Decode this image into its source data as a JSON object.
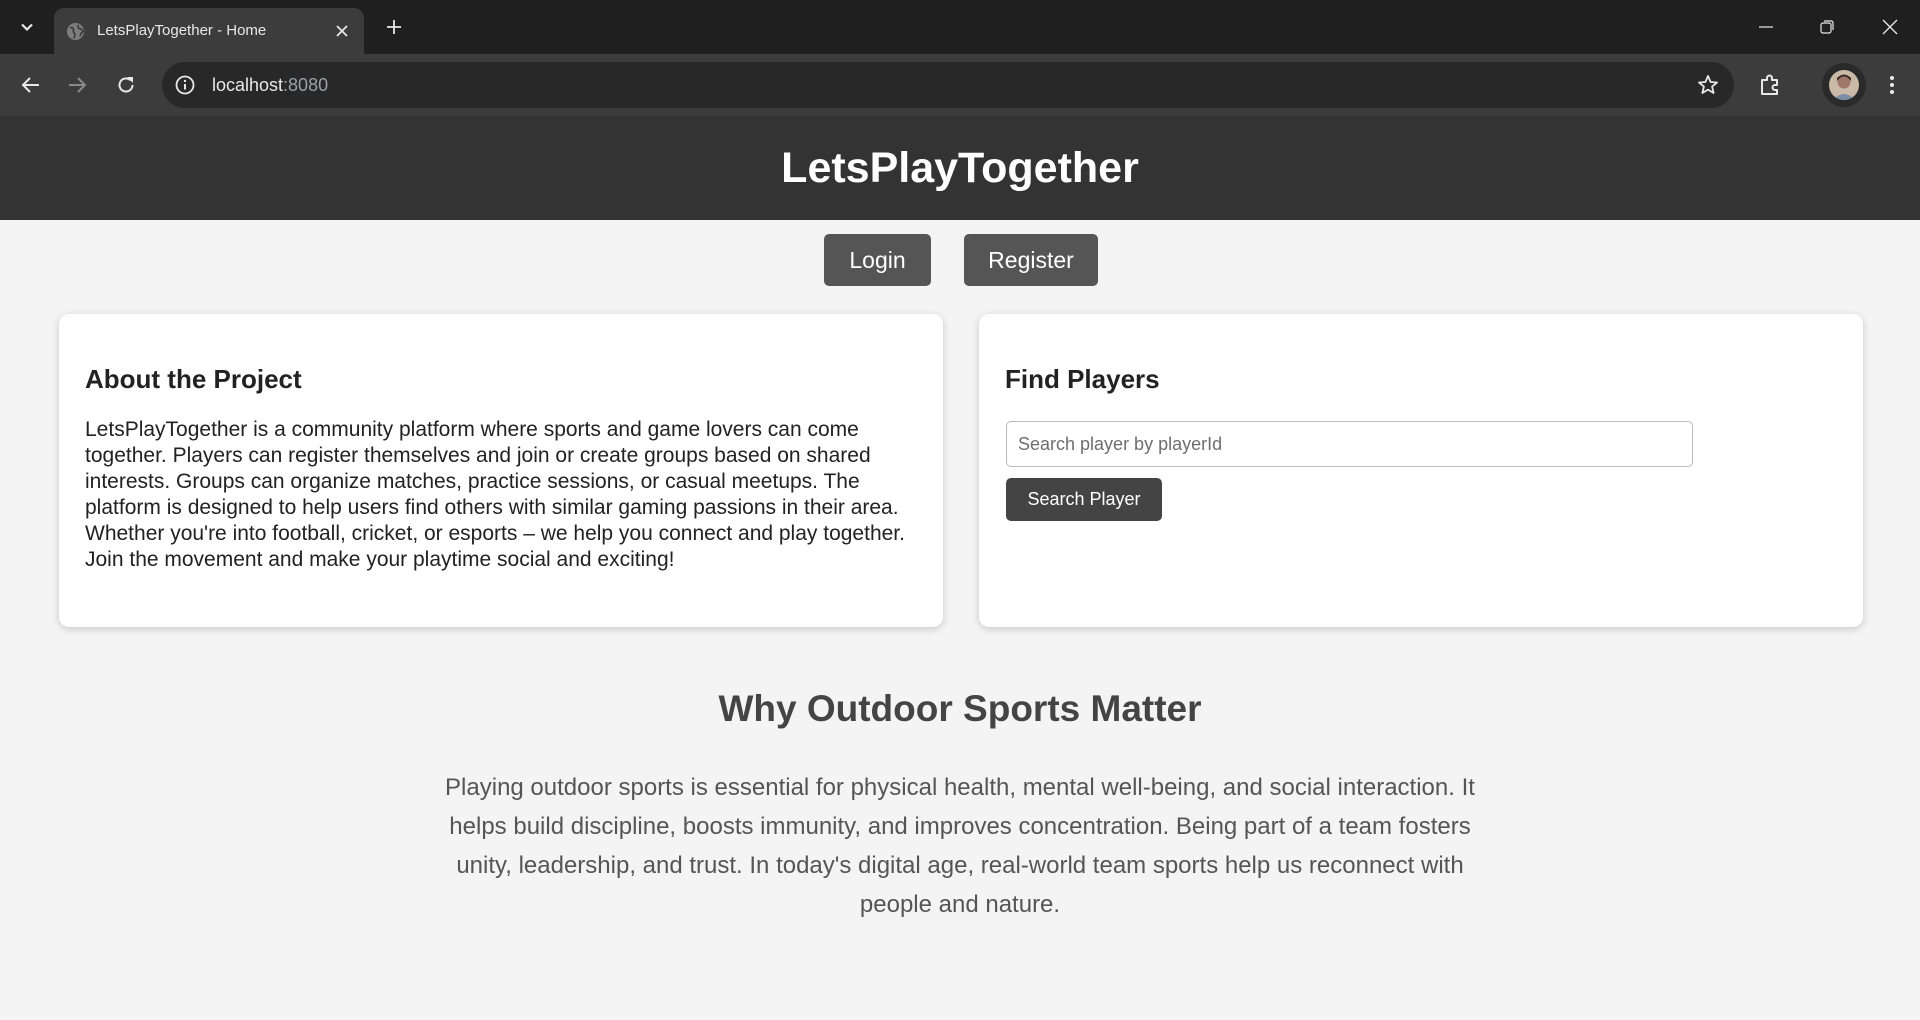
{
  "browser": {
    "tab_title": "LetsPlayTogether - Home",
    "url_host": "localhost",
    "url_port": ":8080"
  },
  "site": {
    "title": "LetsPlayTogether"
  },
  "auth": {
    "login_label": "Login",
    "register_label": "Register"
  },
  "about": {
    "heading": "About the Project",
    "body": "LetsPlayTogether is a community platform where sports and game lovers can come together. Players can register themselves and join or create groups based on shared interests. Groups can organize matches, practice sessions, or casual meetups. The platform is designed to help users find others with similar gaming passions in their area. Whether you're into football, cricket, or esports – we help you connect and play together. Join the movement and make your playtime social and exciting!"
  },
  "find_players": {
    "heading": "Find Players",
    "search_placeholder": "Search player by playerId",
    "search_value": "",
    "button_label": "Search Player"
  },
  "why": {
    "heading": "Why Outdoor Sports Matter",
    "body": "Playing outdoor sports is essential for physical health, mental well-being, and social interaction. It helps build discipline, boosts immunity, and improves concentration. Being part of a team fosters unity, leadership, and trust. In today's digital age, real-world team sports help us reconnect with people and nature."
  },
  "colors": {
    "header_bg": "#333333",
    "auth_button_bg": "#555555",
    "search_button_bg": "#444444",
    "page_bg": "#f4f4f4"
  },
  "icons": [
    "tab-search-icon",
    "globe-favicon-icon",
    "close-icon",
    "plus-icon",
    "minimize-icon",
    "restore-icon",
    "back-arrow-icon",
    "forward-arrow-icon",
    "reload-icon",
    "site-info-icon",
    "star-icon",
    "extensions-icon",
    "profile-avatar-icon",
    "more-vert-icon"
  ]
}
